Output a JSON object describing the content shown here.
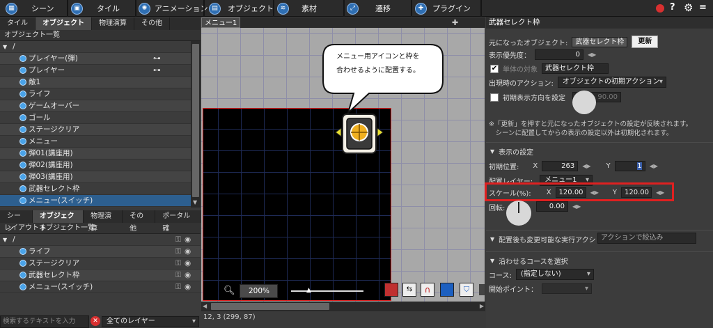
{
  "topmenu": {
    "items": [
      {
        "label": "シーン",
        "icon": "scene-icon"
      },
      {
        "label": "タイル",
        "icon": "tile-icon"
      },
      {
        "label": "アニメーション",
        "icon": "animation-icon"
      },
      {
        "label": "オブジェクト",
        "icon": "object-icon"
      },
      {
        "label": "素材",
        "icon": "material-icon"
      },
      {
        "label": "遷移",
        "icon": "transition-icon"
      },
      {
        "label": "プラグイン",
        "icon": "plugin-icon"
      }
    ],
    "right_icons": [
      "record-icon",
      "help-icon",
      "settings-icon",
      "menu-icon"
    ]
  },
  "left_top": {
    "tabs": [
      "タイル",
      "オブジェクト",
      "物理演算",
      "その他"
    ],
    "active_tab": "オブジェクト",
    "header": "オブジェクト一覧",
    "root": "/",
    "items": [
      {
        "label": "プレイヤー(弾)",
        "badge": true
      },
      {
        "label": "プレイヤー",
        "badge": true
      },
      {
        "label": "敵1"
      },
      {
        "label": "ライフ"
      },
      {
        "label": "ゲームオーバー"
      },
      {
        "label": "ゴール"
      },
      {
        "label": "ステージクリア"
      },
      {
        "label": "メニュー"
      },
      {
        "label": "弾01(講座用)"
      },
      {
        "label": "弾02(講座用)"
      },
      {
        "label": "弾03(講座用)"
      },
      {
        "label": "武器セレクト枠"
      },
      {
        "label": "メニュー(スイッチ)",
        "selected": true
      }
    ]
  },
  "left_bottom": {
    "tabs": [
      "シーン",
      "オブジェクト",
      "物理演算",
      "その他",
      "ポータル確"
    ],
    "active_tab": "オブジェクト",
    "header": "レイアウトオブジェクト一覧",
    "root": "/",
    "items": [
      {
        "label": "ライフ"
      },
      {
        "label": "ステージクリア"
      },
      {
        "label": "武器セレクト枠"
      },
      {
        "label": "メニュー(スイッチ)"
      }
    ],
    "search_placeholder": "検索するテキストを入力",
    "layer_filter": "全てのレイヤー"
  },
  "canvas": {
    "tab": "メニュー1",
    "bubble_text": "メニュー用アイコンと枠を\n合わせるように配置する。",
    "zoom": "200%",
    "status": "12, 3 (299, 87)"
  },
  "inspector": {
    "title": "武器セレクト枠",
    "source_label": "元になったオブジェクト:",
    "source_value": "武器セレクト枠",
    "update_button": "更新",
    "priority_label": "表示優先度：",
    "priority_value": "0",
    "single_target_label": "単体の対象",
    "single_target_value": "武器セレクト枠",
    "appear_action_label": "出現時のアクション:",
    "appear_action_value": "オブジェクトの初期アクション",
    "initial_direction_label": "初期表示方向を設定",
    "direction_value": "90.00",
    "note": "※「更新」を押すと元になったオブジェクトの設定が反映されます。\n　シーンに配置してからの表示の設定以外は初期化されます。",
    "display_section": "表示の設定",
    "initial_pos_label": "初期位置:",
    "x_label": "X",
    "x_value": "263",
    "y_label": "Y",
    "y_value": "1",
    "layer_label": "配置レイヤー:",
    "layer_value": "メニュー1",
    "scale_label": "スケール(%):",
    "scale_x": "120.00",
    "scale_y": "120.00",
    "rotation_label": "回転:",
    "rotation_value": "0.00",
    "actions_section": "配置後も変更可能な実行アクシ",
    "actions_filter": "アクションで絞込み",
    "course_section": "沿わせるコースを選択",
    "course_label": "コース:",
    "course_value": "(指定しない)",
    "start_point_label": "開始ポイント："
  },
  "colors": {
    "highlight": "#e02020",
    "selection": "#2d5f8f",
    "accent_blue": "#2f6fb3"
  }
}
